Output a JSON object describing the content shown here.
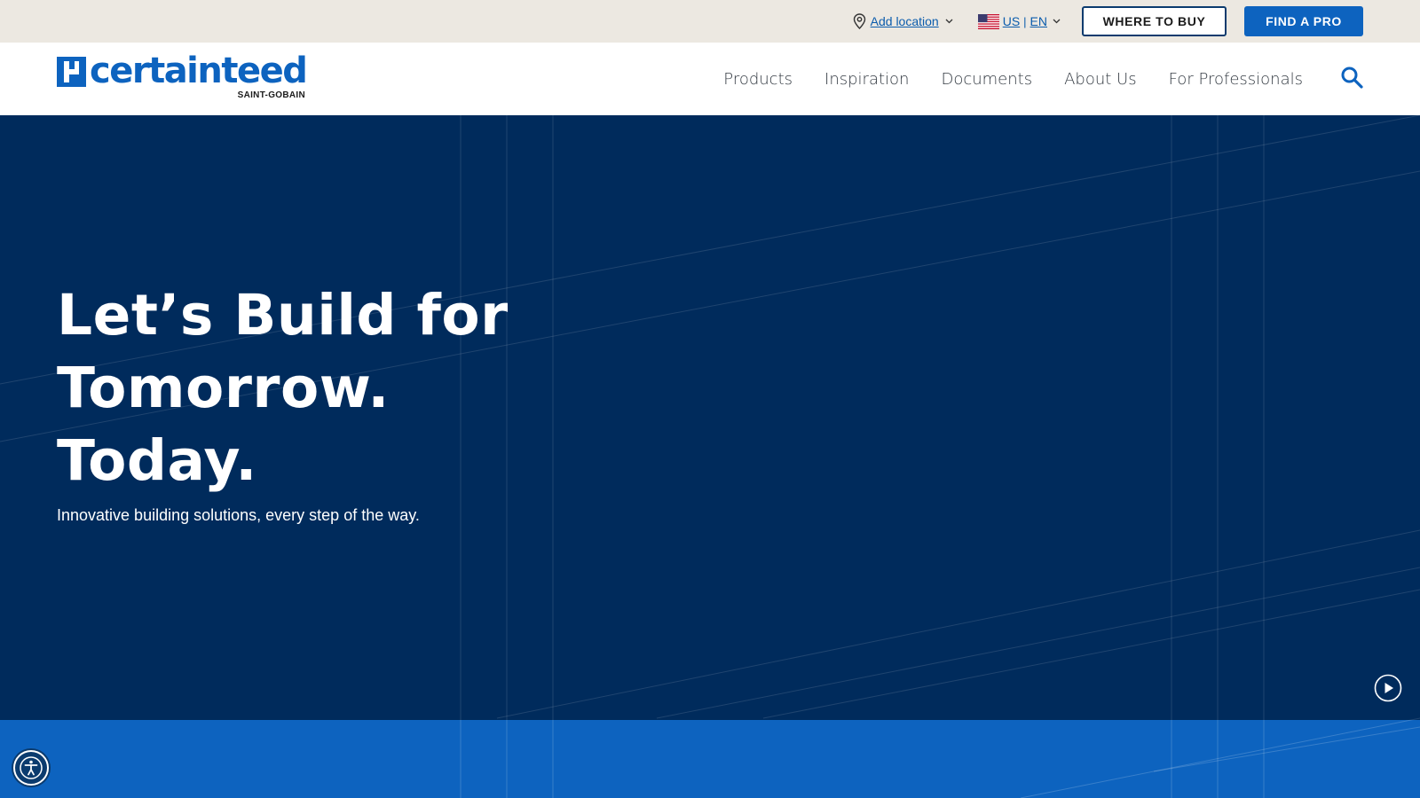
{
  "utility": {
    "location_label": "Add location",
    "country": "US",
    "language": "EN",
    "where_to_buy": "WHERE TO BUY",
    "find_a_pro": "FIND A PRO"
  },
  "brand": {
    "name": "certainteed",
    "parent": "SAINT-GOBAIN"
  },
  "nav": {
    "items": [
      "Products",
      "Inspiration",
      "Documents",
      "About Us",
      "For Professionals"
    ]
  },
  "hero": {
    "title_lines": [
      "Let’s Build for",
      "Tomorrow.",
      "Today."
    ],
    "subtitle": "Innovative building solutions, every step of the way."
  },
  "icons": {
    "location": "map-pin-icon",
    "language": "us-flag-icon",
    "search": "search-icon",
    "video": "play-icon",
    "accessibility": "accessibility-icon"
  },
  "colors": {
    "utility_bg": "#ece8e1",
    "brand_blue": "#0d63bf",
    "hero_navy": "#002b5c",
    "outline_border": "#0b3b6e"
  }
}
